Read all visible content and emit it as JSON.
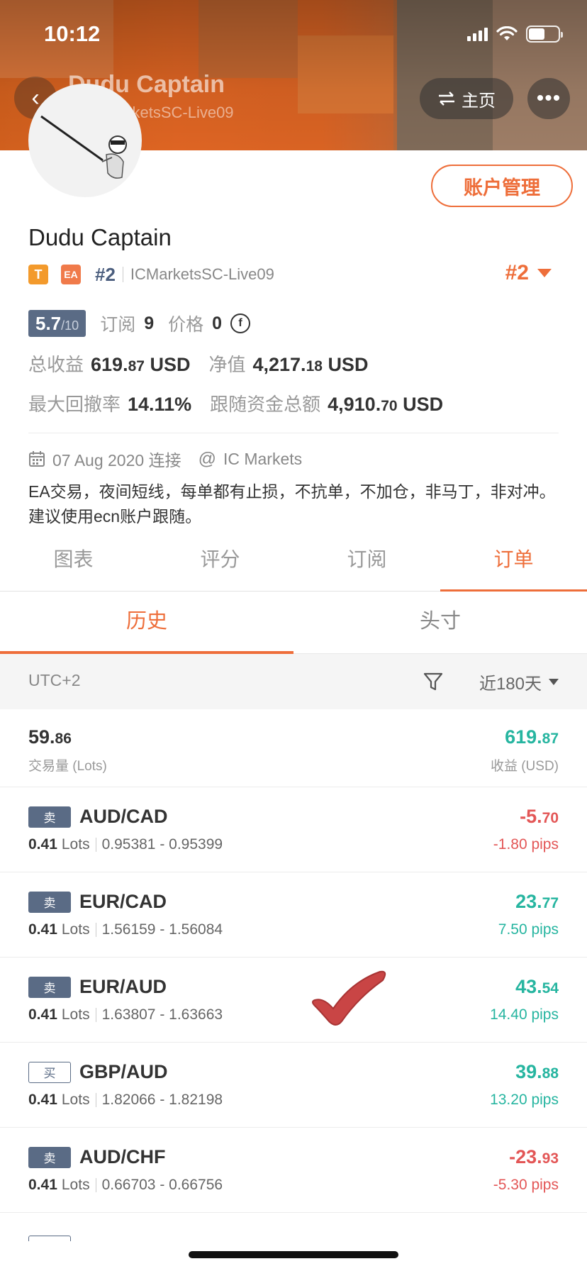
{
  "status": {
    "time": "10:12"
  },
  "header": {
    "name": "Dudu Captain",
    "sub": "#2 ICMarketsSC-Live09",
    "home_label": "主页",
    "more_label": "•••"
  },
  "profile": {
    "account_button": "账户管理",
    "name": "Dudu Captain",
    "tag_t": "T",
    "tag_ea": "EA",
    "rank": "#2",
    "server": "ICMarketsSC-Live09",
    "rank_right": "#2",
    "score": "5.7",
    "score_max": "/10",
    "subscribe_label": "订阅",
    "subscribe_count": "9",
    "price_label": "价格",
    "price_value": "0",
    "coin_symbol": "f",
    "total_profit_label": "总收益",
    "total_profit_int": "619.",
    "total_profit_dec": "87",
    "total_profit_unit": "USD",
    "equity_label": "净值",
    "equity_int": "4,217.",
    "equity_dec": "18",
    "equity_unit": "USD",
    "drawdown_label": "最大回撤率",
    "drawdown_value": "14.11%",
    "follow_label": "跟随资金总额",
    "follow_int": "4,910.",
    "follow_dec": "70",
    "follow_unit": "USD",
    "connect_date": "07 Aug 2020 连接",
    "broker": "IC Markets",
    "description": "EA交易，夜间短线，每单都有止损，不抗单，不加仓，非马丁，非对冲。建议使用ecn账户跟随。"
  },
  "tabs": [
    "图表",
    "评分",
    "订阅",
    "订单"
  ],
  "subtabs": [
    "历史",
    "头寸"
  ],
  "filter": {
    "timezone": "UTC+2",
    "period": "近180天"
  },
  "summary": {
    "lots_int": "59.",
    "lots_dec": "86",
    "lots_label": "交易量 (Lots)",
    "profit_int": "619.",
    "profit_dec": "87",
    "profit_label": "收益 (USD)"
  },
  "orders": [
    {
      "side": "卖",
      "pair": "AUD/CAD",
      "lots": "0.41",
      "lots_unit": "Lots",
      "range": "0.95381 - 0.95399",
      "pnl_int": "-5.",
      "pnl_dec": "70",
      "pips": "-1.80 pips",
      "positive": false
    },
    {
      "side": "卖",
      "pair": "EUR/CAD",
      "lots": "0.41",
      "lots_unit": "Lots",
      "range": "1.56159 - 1.56084",
      "pnl_int": "23.",
      "pnl_dec": "77",
      "pips": "7.50 pips",
      "positive": true
    },
    {
      "side": "卖",
      "pair": "EUR/AUD",
      "lots": "0.41",
      "lots_unit": "Lots",
      "range": "1.63807 - 1.63663",
      "pnl_int": "43.",
      "pnl_dec": "54",
      "pips": "14.40 pips",
      "positive": true
    },
    {
      "side": "买",
      "pair": "GBP/AUD",
      "lots": "0.41",
      "lots_unit": "Lots",
      "range": "1.82066 - 1.82198",
      "pnl_int": "39.",
      "pnl_dec": "88",
      "pips": "13.20 pips",
      "positive": true
    },
    {
      "side": "卖",
      "pair": "AUD/CHF",
      "lots": "0.41",
      "lots_unit": "Lots",
      "range": "0.66703 - 0.66756",
      "pnl_int": "-23.",
      "pnl_dec": "93",
      "pips": "-5.30 pips",
      "positive": false
    }
  ],
  "colors": {
    "accent": "#ee6e3a",
    "positive": "#26b5a0",
    "negative": "#e35656",
    "sell_badge": "#5a6b85"
  },
  "icons": [
    "back-icon",
    "swap-icon",
    "more-icon",
    "calendar-icon",
    "at-icon",
    "filter-icon",
    "caret-down-icon",
    "checkmark-icon"
  ]
}
